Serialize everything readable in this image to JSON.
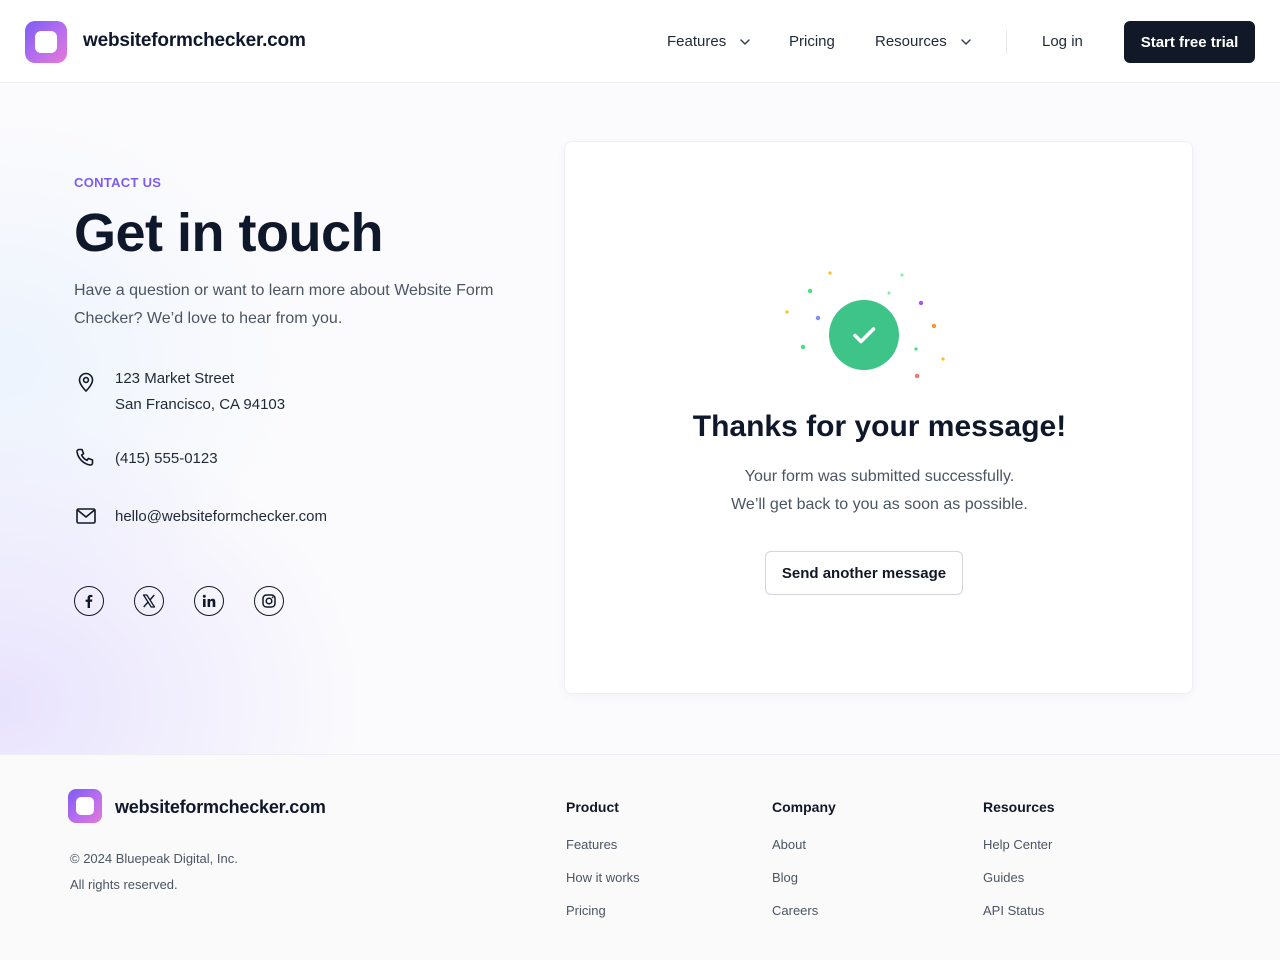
{
  "header": {
    "brand": "websiteformchecker.com",
    "nav": {
      "features": "Features",
      "pricing": "Pricing",
      "resources": "Resources",
      "login": "Log in"
    },
    "cta": "Start free trial"
  },
  "contact": {
    "eyebrow": "CONTACT US",
    "title": "Get in touch",
    "intro": "Have a question or want to learn more about Website Form Checker? We’d love to hear from you.",
    "address_line1": "123 Market Street",
    "address_line2": "San Francisco, CA  94103",
    "phone": "(415) 555-0123",
    "email": "hello@websiteformchecker.com",
    "socials": [
      "facebook-icon",
      "x-twitter-icon",
      "linkedin-icon",
      "instagram-icon"
    ]
  },
  "success": {
    "title": "Thanks for your message!",
    "line1": "Your form was submitted successfully.",
    "line2": "We’ll get back to you as soon as possible.",
    "button": "Send another message",
    "accent": "#3ec489"
  },
  "footer": {
    "brand": "websiteformchecker.com",
    "copyright": "© 2024 Bluepeak Digital, Inc.",
    "rights": "All rights reserved.",
    "columns": [
      {
        "heading": "Product",
        "links": [
          "Features",
          "How it works",
          "Pricing"
        ]
      },
      {
        "heading": "Company",
        "links": [
          "About",
          "Blog",
          "Careers"
        ]
      },
      {
        "heading": "Resources",
        "links": [
          "Help Center",
          "Guides",
          "API Status"
        ]
      }
    ]
  },
  "colors": {
    "brand_purple": "#7c5cf2",
    "dark": "#111827",
    "success_green": "#3ec489"
  }
}
